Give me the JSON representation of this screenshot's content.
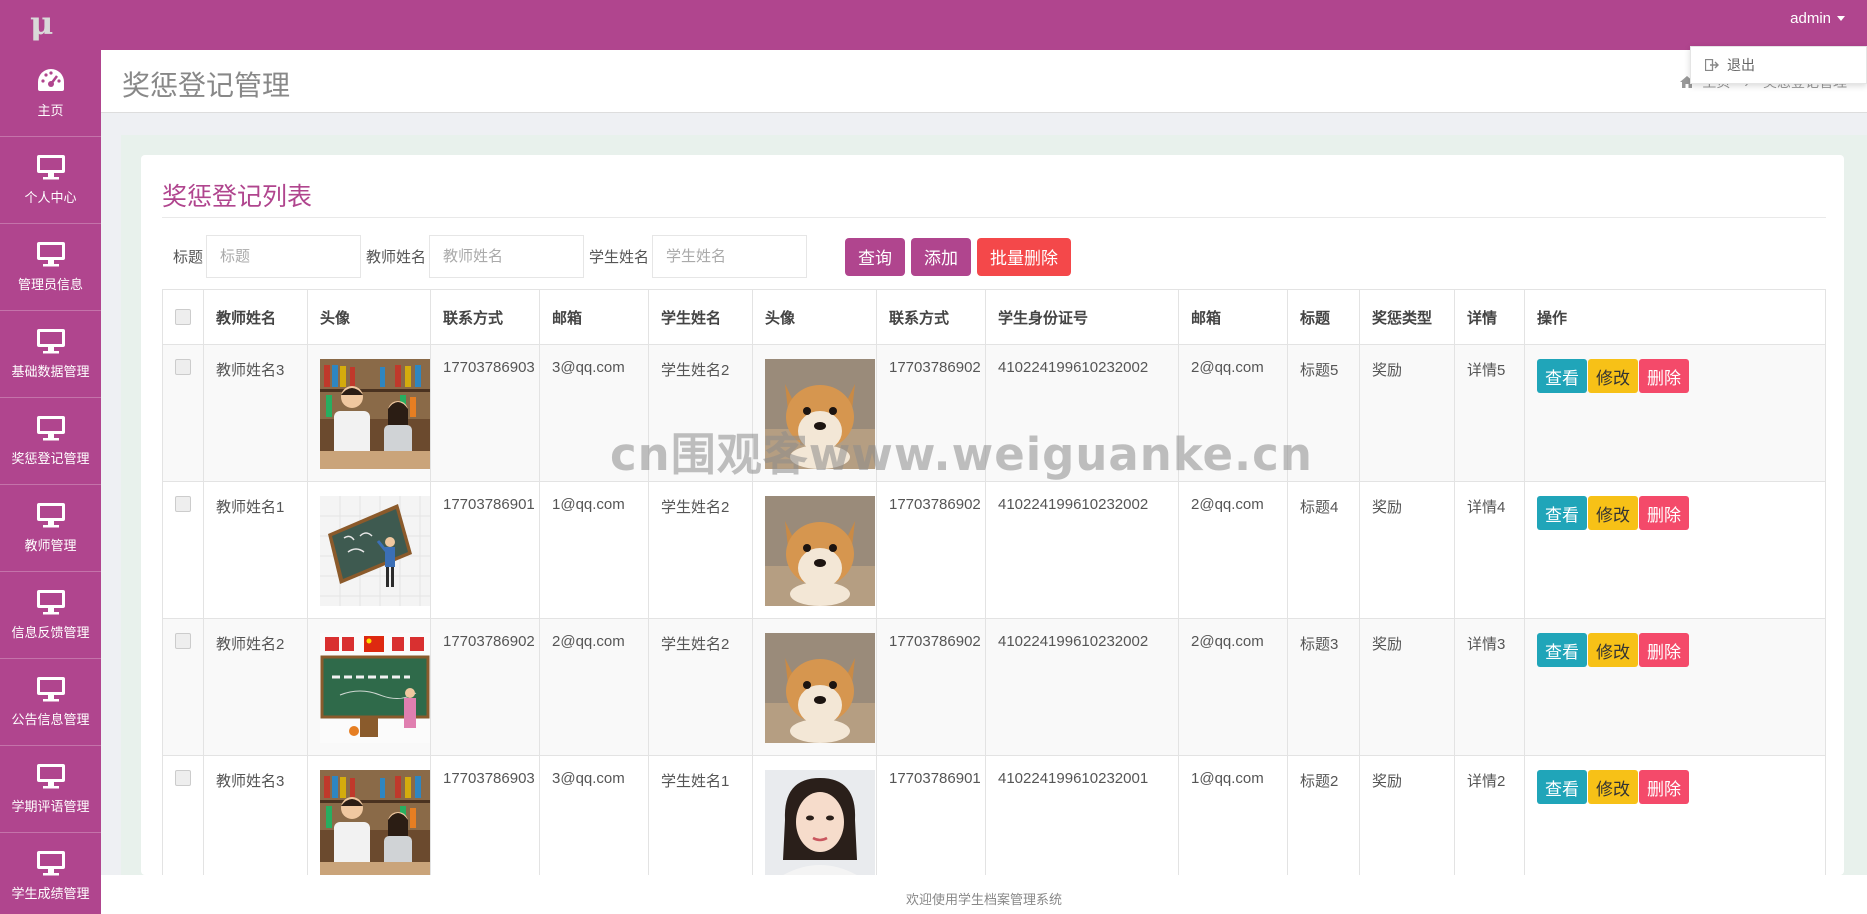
{
  "topbar": {
    "logo": "μ",
    "user": "admin",
    "dropdown_logout": "退出"
  },
  "sidebar": {
    "items": [
      {
        "label": "主页",
        "icon": "dashboard-icon"
      },
      {
        "label": "个人中心",
        "icon": "monitor-icon"
      },
      {
        "label": "管理员信息",
        "icon": "monitor-icon"
      },
      {
        "label": "基础数据管理",
        "icon": "monitor-icon"
      },
      {
        "label": "奖惩登记管理",
        "icon": "monitor-icon"
      },
      {
        "label": "教师管理",
        "icon": "monitor-icon"
      },
      {
        "label": "信息反馈管理",
        "icon": "monitor-icon"
      },
      {
        "label": "公告信息管理",
        "icon": "monitor-icon"
      },
      {
        "label": "学期评语管理",
        "icon": "monitor-icon"
      },
      {
        "label": "学生成绩管理",
        "icon": "monitor-icon"
      }
    ]
  },
  "header": {
    "title": "奖惩登记管理",
    "breadcrumb_home": "主页",
    "breadcrumb_current": "奖惩登记管理"
  },
  "card": {
    "title": "奖惩登记列表"
  },
  "search": {
    "label_title": "标题",
    "placeholder_title": "标题",
    "label_teacher": "教师姓名",
    "placeholder_teacher": "教师姓名",
    "label_student": "学生姓名",
    "placeholder_student": "学生姓名",
    "btn_query": "查询",
    "btn_add": "添加",
    "btn_batch_delete": "批量删除"
  },
  "table": {
    "headers": [
      "教师姓名",
      "头像",
      "联系方式",
      "邮箱",
      "学生姓名",
      "头像",
      "联系方式",
      "学生身份证号",
      "邮箱",
      "标题",
      "奖惩类型",
      "详情",
      "操作"
    ],
    "rows": [
      {
        "teacher": "教师姓名3",
        "t_avatar": "classroom-photo",
        "t_phone": "17703786903",
        "t_email": "3@qq.com",
        "student": "学生姓名2",
        "s_avatar": "dog-photo",
        "s_phone": "17703786902",
        "s_id": "410224199610232002",
        "s_email": "2@qq.com",
        "title": "标题5",
        "type": "奖励",
        "detail": "详情5"
      },
      {
        "teacher": "教师姓名1",
        "t_avatar": "blackboard-illustration",
        "t_phone": "17703786901",
        "t_email": "1@qq.com",
        "student": "学生姓名2",
        "s_avatar": "dog-photo",
        "s_phone": "17703786902",
        "s_id": "410224199610232002",
        "s_email": "2@qq.com",
        "title": "标题4",
        "type": "奖励",
        "detail": "详情4"
      },
      {
        "teacher": "教师姓名2",
        "t_avatar": "teachers-day-poster",
        "t_phone": "17703786902",
        "t_email": "2@qq.com",
        "student": "学生姓名2",
        "s_avatar": "dog-photo",
        "s_phone": "17703786902",
        "s_id": "410224199610232002",
        "s_email": "2@qq.com",
        "title": "标题3",
        "type": "奖励",
        "detail": "详情3"
      },
      {
        "teacher": "教师姓名3",
        "t_avatar": "classroom-photo",
        "t_phone": "17703786903",
        "t_email": "3@qq.com",
        "student": "学生姓名1",
        "s_avatar": "woman-portrait",
        "s_phone": "17703786901",
        "s_id": "410224199610232001",
        "s_email": "1@qq.com",
        "title": "标题2",
        "type": "奖励",
        "detail": "详情2"
      }
    ],
    "op_view": "查看",
    "op_edit": "修改",
    "op_delete": "删除"
  },
  "watermark": "cn围观客www.weiguanke.cn",
  "footer": "欢迎使用学生档案管理系统",
  "colors": {
    "brand": "#b0458e",
    "danger": "#f4484a",
    "info": "#20a5b9",
    "warning": "#f7c117",
    "delete": "#f44a6a"
  }
}
